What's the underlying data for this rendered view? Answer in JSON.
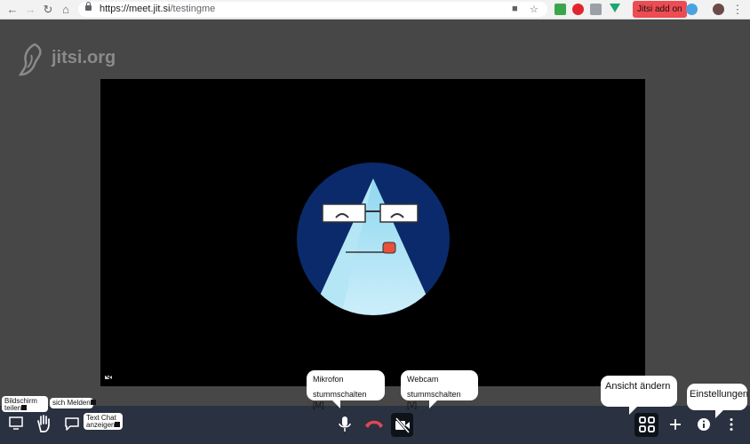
{
  "browser": {
    "url_host": "https://meet.jit.si",
    "url_path": "/testingme",
    "extension_popup_label": "Jitsi add on"
  },
  "page": {
    "logo_text": "jitsi.org"
  },
  "toolbar": {
    "share_screen_tip": "Bildschirm teilen",
    "raise_hand_tip": "sich Melden",
    "chat_tip": "Text Chat anzeigen",
    "mic_tip_line1": "Mikrofon",
    "mic_tip_line2": "stummschalten [M]",
    "cam_tip_line1": "Webcam",
    "cam_tip_line2": "stummschalten [V]",
    "view_tip": "Ansicht ändern",
    "settings_tip": "Einstellungen"
  },
  "colors": {
    "toolbar_bg": "#2a3140",
    "stage_bg": "#000000",
    "page_bg": "#474747",
    "hangup": "#e04757",
    "avatar_bg": "#0b2a6b"
  }
}
